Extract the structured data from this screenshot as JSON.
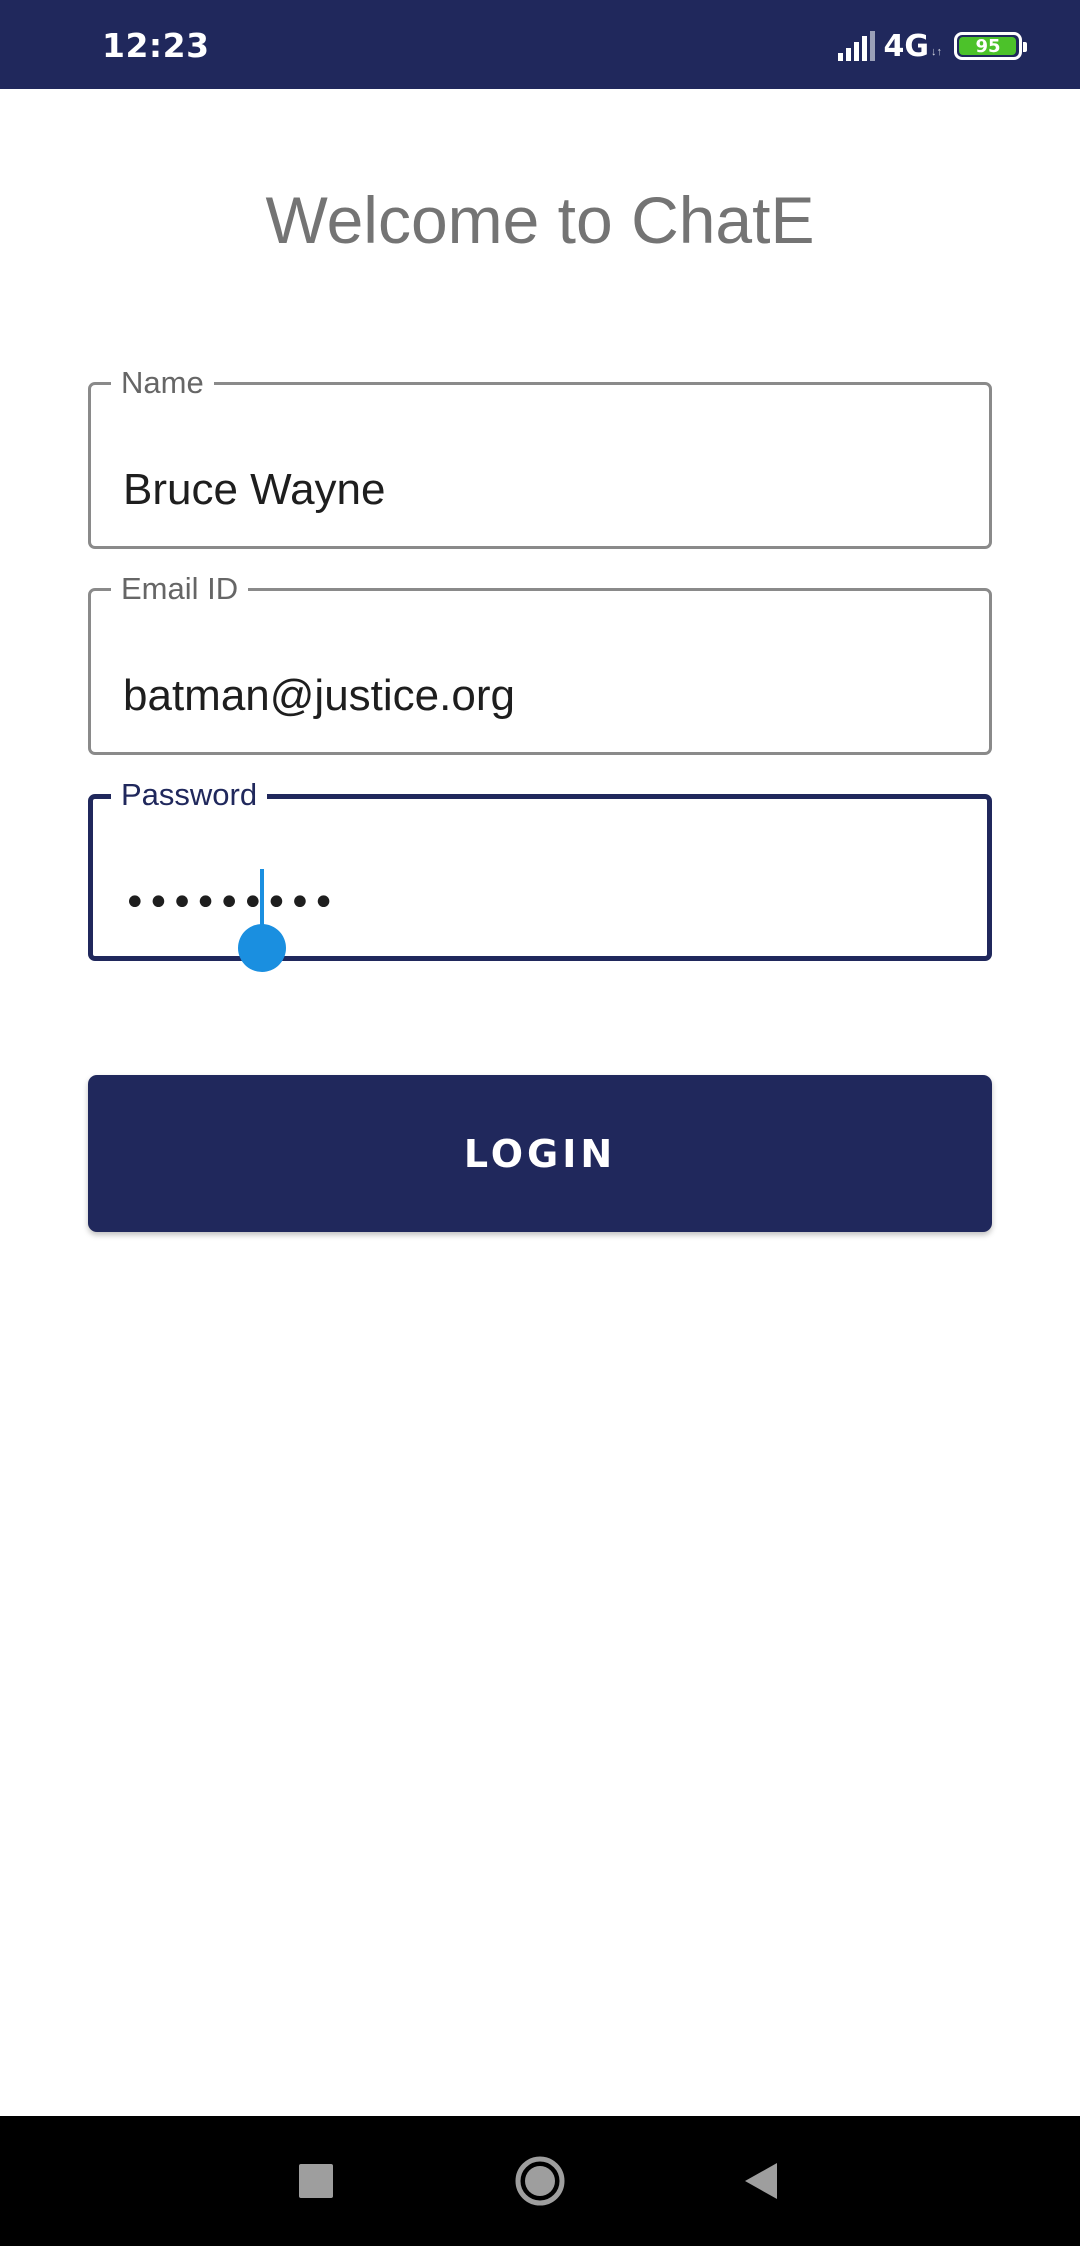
{
  "status_bar": {
    "time": "12:23",
    "network": "4G",
    "battery_level": "95",
    "icons": [
      "signal-icon",
      "battery-icon"
    ]
  },
  "title": "Welcome to ChatE",
  "form": {
    "name": {
      "label": "Name",
      "value": "Bruce Wayne"
    },
    "email": {
      "label": "Email ID",
      "value": "batman@justice.org"
    },
    "password": {
      "label": "Password",
      "value": "•••••••••"
    }
  },
  "login_button": {
    "label": "LOGIN"
  },
  "nav_bar": {
    "icons": [
      "recents-icon",
      "home-icon",
      "back-icon"
    ]
  },
  "colors": {
    "primary": "#20285c",
    "title_text": "#747474",
    "cursor": "#1a8fe0",
    "battery": "#4cc22a"
  }
}
